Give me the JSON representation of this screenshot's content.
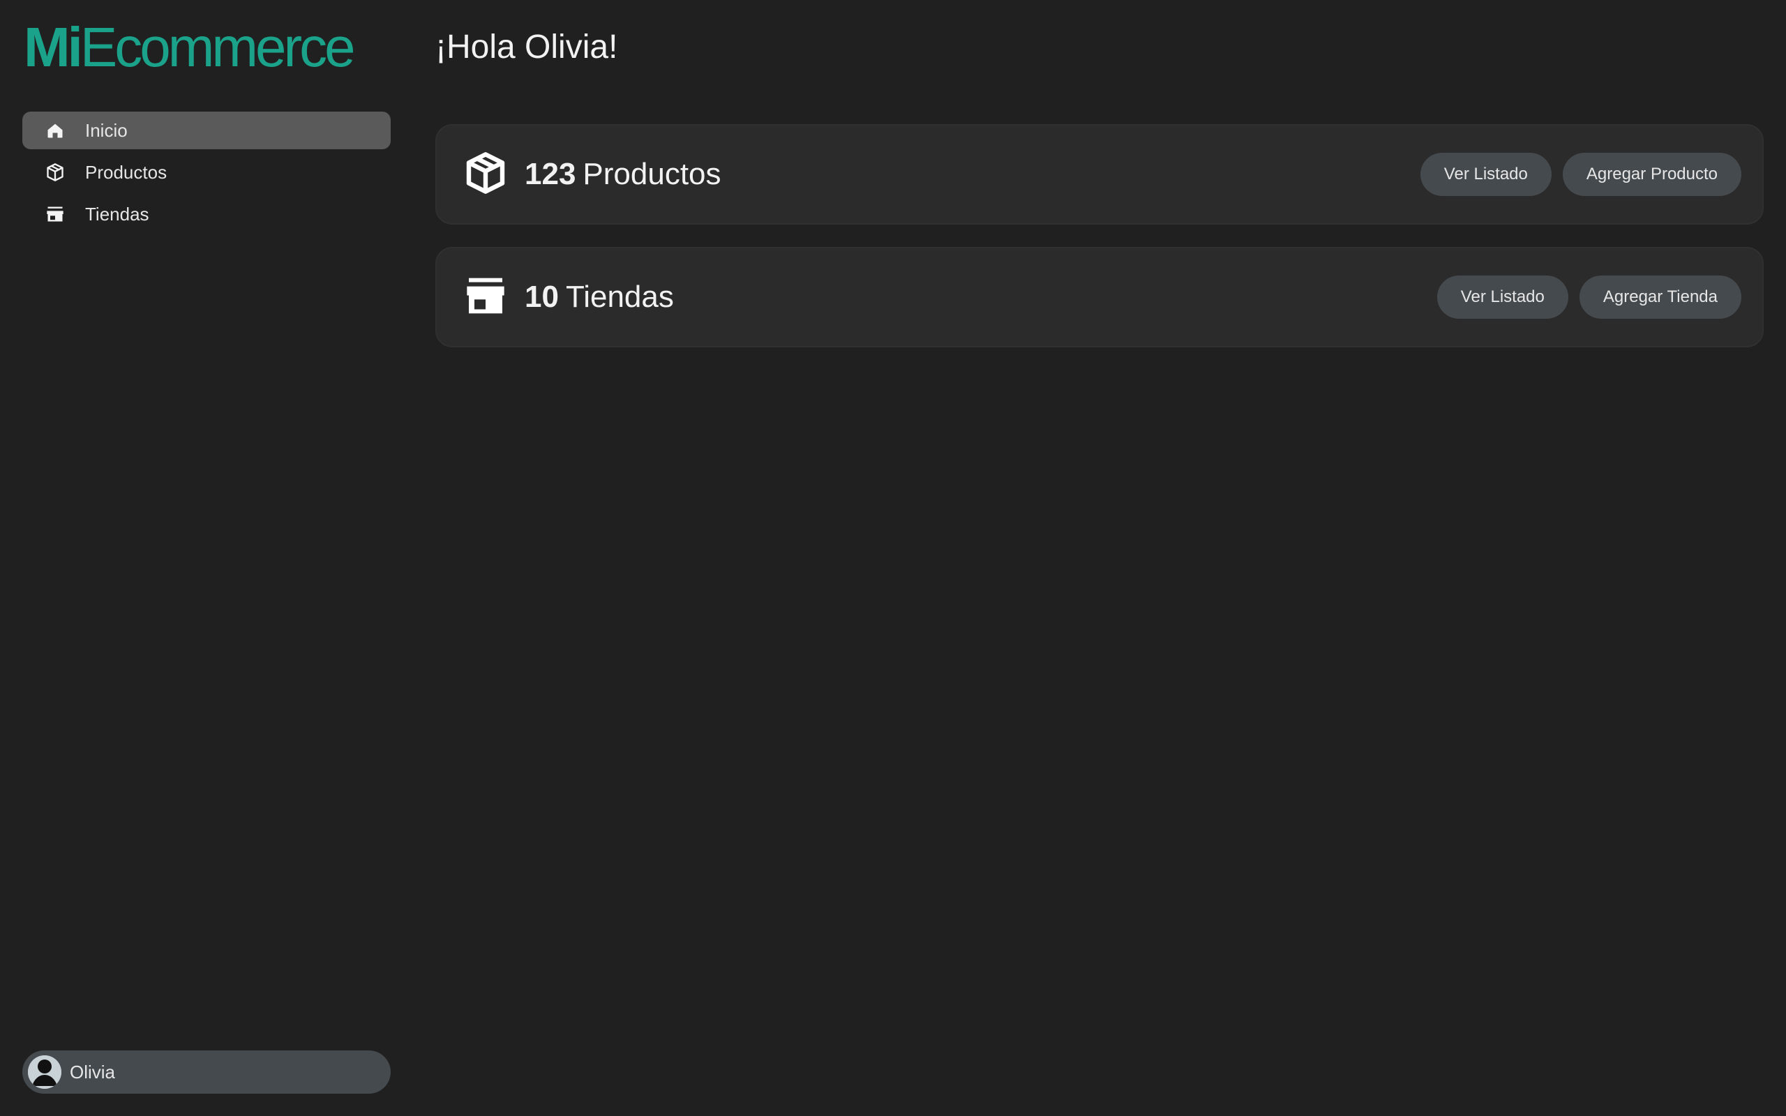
{
  "brand": {
    "part1": "Mi",
    "part2": "Ecommerce",
    "color": "#1aa38a"
  },
  "sidebar": {
    "items": [
      {
        "label": "Inicio",
        "icon": "home-icon",
        "active": true
      },
      {
        "label": "Productos",
        "icon": "package-icon",
        "active": false
      },
      {
        "label": "Tiendas",
        "icon": "store-icon",
        "active": false
      }
    ]
  },
  "user": {
    "name": "Olivia",
    "avatar": "avatar-icon"
  },
  "main": {
    "greeting": "¡Hola Olivia!",
    "cards": [
      {
        "count": "123",
        "label": "Productos",
        "icon": "package-icon",
        "actions": [
          "Ver Listado",
          "Agregar Producto"
        ]
      },
      {
        "count": "10",
        "label": "Tiendas",
        "icon": "store-icon",
        "actions": [
          "Ver Listado",
          "Agregar Tienda"
        ]
      }
    ]
  }
}
